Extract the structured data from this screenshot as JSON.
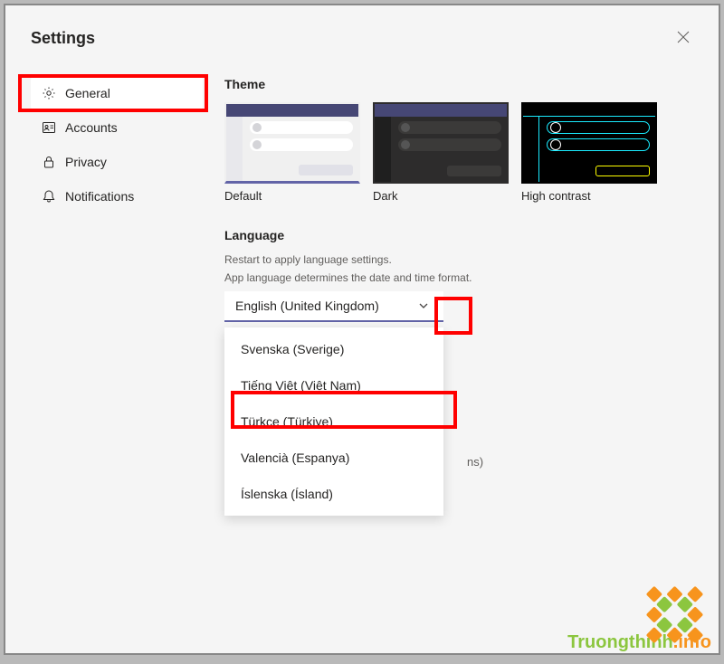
{
  "header": {
    "title": "Settings"
  },
  "sidebar": {
    "items": [
      {
        "label": "General",
        "icon": "gear-icon",
        "active": true
      },
      {
        "label": "Accounts",
        "icon": "profile-icon",
        "active": false
      },
      {
        "label": "Privacy",
        "icon": "lock-icon",
        "active": false
      },
      {
        "label": "Notifications",
        "icon": "bell-icon",
        "active": false
      }
    ]
  },
  "main": {
    "theme_section_title": "Theme",
    "themes": [
      {
        "label": "Default",
        "selected": true
      },
      {
        "label": "Dark",
        "selected": false
      },
      {
        "label": "High contrast",
        "selected": false
      }
    ],
    "language_section_title": "Language",
    "language_hint": "Restart to apply language settings.",
    "language_desc": "App language determines the date and time format.",
    "language_selected": "English (United Kingdom)",
    "language_options": [
      "Svenska (Sverige)",
      "Tiếng Việt (Việt Nam)",
      "Türkçe (Türkiye)",
      "Valencià (Espanya)",
      "Íslenska (Ísland)"
    ],
    "partial_text": "ns)"
  },
  "watermark": {
    "text_main": "Truongthinh",
    "text_suffix": ".info"
  }
}
